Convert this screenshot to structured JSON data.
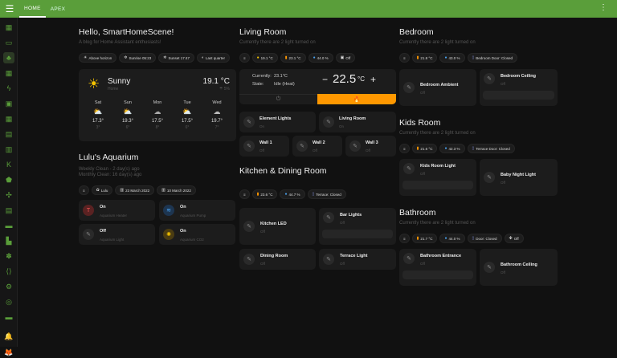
{
  "tabs": [
    "HOME",
    "APEX"
  ],
  "sidebar": {
    "items": [
      "dashboard-icon",
      "monitor-icon",
      "tree-icon",
      "grid-icon",
      "bolt-icon",
      "person-icon",
      "grid2-icon",
      "map-icon",
      "calendar-icon",
      "k-icon",
      "shield-icon",
      "network-icon",
      "list-icon",
      "store-icon",
      "chart-icon",
      "puzzle-icon",
      "code-icon",
      "gear-icon",
      "compass-icon",
      "car-icon",
      "bell-icon",
      "user-icon"
    ]
  },
  "hello": {
    "title": "Hello, SmartHomeScene!",
    "subtitle": "A blog for Home Assistant enthusiasts!",
    "chips": [
      "Above horizon",
      "Sunrise 05:23",
      "Sunset 17:47",
      "Last quarter"
    ]
  },
  "weather": {
    "condition": "Sunny",
    "location": "Home",
    "temp": "19.1 °C",
    "extra": "5%",
    "forecast": [
      {
        "day": "Sat",
        "hi": "17.3°",
        "lo": "3°"
      },
      {
        "day": "Sun",
        "hi": "19.3°",
        "lo": "6°"
      },
      {
        "day": "Mon",
        "hi": "17.5°",
        "lo": "8°"
      },
      {
        "day": "Tue",
        "hi": "17.5°",
        "lo": "6°"
      },
      {
        "day": "Wed",
        "hi": "19.7°",
        "lo": "7°"
      }
    ]
  },
  "aquarium": {
    "title": "Lulu's Aquarium",
    "line1": "Weekly Clean - 2 day(s) ago",
    "line2": "Monthly Clean: 16 day(s) ago",
    "chips": [
      "Lulu",
      "23 March 2022",
      "10 March 2022"
    ],
    "tiles": [
      {
        "state": "On",
        "name": "Aquarium Heater"
      },
      {
        "state": "On",
        "name": "Aquarium Pump"
      },
      {
        "state": "Off",
        "name": "Aquarium Light"
      },
      {
        "state": "On",
        "name": "Aquarium CO2"
      }
    ]
  },
  "living": {
    "title": "Living Room",
    "subtitle": "Currently there are 2 light turned on",
    "chips": [
      "19.1 °C",
      "23.1 °C",
      "44.0 %",
      "Off"
    ],
    "current_label": "Currently:",
    "current_val": "23.1°C",
    "state_label": "State:",
    "state_val": "Idle (Heat)",
    "setpoint": "22.5",
    "unit": "°C",
    "lights": [
      {
        "name": "Element Lights",
        "state": "On"
      },
      {
        "name": "Living Room",
        "state": "On"
      }
    ],
    "walls": [
      {
        "name": "Wall 1",
        "state": "Off"
      },
      {
        "name": "Wall 2",
        "state": "Off"
      },
      {
        "name": "Wall 3",
        "state": "Off"
      }
    ]
  },
  "kitchen": {
    "title": "Kitchen & Dining Room",
    "chips": [
      "23.6 °C",
      "44.7 %",
      "Terrace: Closed"
    ],
    "tiles": [
      {
        "name": "Kitchen LED",
        "state": "Off"
      },
      {
        "name": "Bar Lights",
        "state": "Off"
      },
      {
        "name": "Dining Room",
        "state": "Off"
      },
      {
        "name": "Terrace Light",
        "state": "Off"
      }
    ]
  },
  "bedroom": {
    "title": "Bedroom",
    "subtitle": "Currently there are 2 light turned on",
    "chips": [
      "21.8 °C",
      "43.0 %",
      "Bedroom Door: Closed"
    ],
    "tiles": [
      {
        "name": "Bedroom Ambient",
        "state": "Off"
      },
      {
        "name": "Bedroom Ceiling",
        "state": "Off"
      }
    ]
  },
  "kids": {
    "title": "Kids Room",
    "subtitle": "Currently there are 2 light turned on",
    "chips": [
      "21.6 °C",
      "42.3 %",
      "Terrace Door: Closed"
    ],
    "tiles": [
      {
        "name": "Kids Room Light",
        "state": "Off"
      },
      {
        "name": "Baby Night Light",
        "state": "Off"
      }
    ]
  },
  "bathroom": {
    "title": "Bathroom",
    "subtitle": "Currently there are 2 light turned on",
    "chips": [
      "21.7 °C",
      "44.0 %",
      "Door: Closed",
      "Off"
    ],
    "tiles": [
      {
        "name": "Bathroom Entrance",
        "state": "Off"
      },
      {
        "name": "Bathroom Ceiling",
        "state": "Off"
      }
    ]
  },
  "colors": {
    "accent": "#5a9e3a",
    "orange": "#ff9800"
  }
}
